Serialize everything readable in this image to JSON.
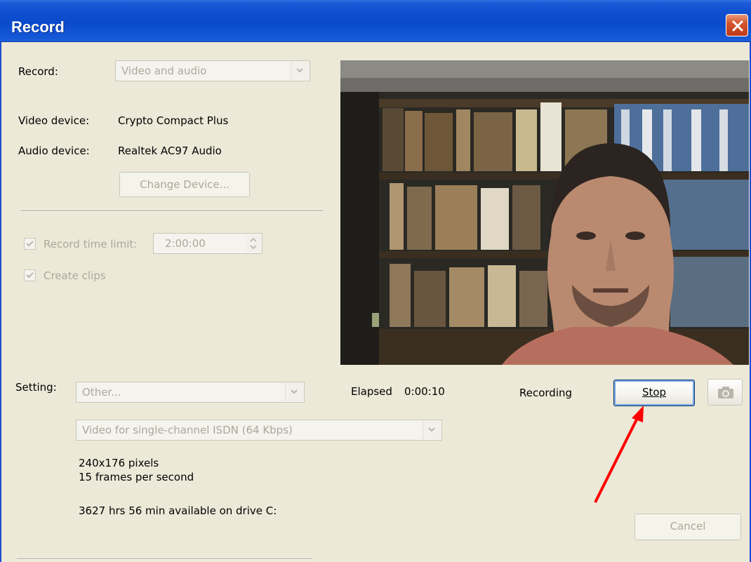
{
  "window": {
    "title": "Record"
  },
  "record": {
    "label": "Record:",
    "mode_value": "Video and audio"
  },
  "devices": {
    "video_label": "Video device:",
    "video_value": "Crypto Compact Plus",
    "audio_label": "Audio device:",
    "audio_value": "Realtek AC97 Audio",
    "change_button": "Change Device..."
  },
  "options": {
    "time_limit_label": "Record time limit:",
    "time_limit_value": "2:00:00",
    "time_limit_checked": true,
    "create_clips_label": "Create clips",
    "create_clips_checked": true
  },
  "status": {
    "elapsed_label": "Elapsed",
    "elapsed_value": "0:00:10",
    "state": "Recording",
    "stop_button": "Stop"
  },
  "setting": {
    "label": "Setting:",
    "profile_value": "Other...",
    "format_value": "Video for single-channel ISDN (64 Kbps)",
    "resolution": "240x176 pixels",
    "framerate": "15 frames per second",
    "available": "3627 hrs  56 min available on drive C:"
  },
  "footer": {
    "cancel_button": "Cancel"
  },
  "icons": {
    "close": "close-icon",
    "dropdown": "chevron-down-icon",
    "camera": "camera-icon",
    "check": "checkmark-icon",
    "annotation": "red-arrow"
  },
  "colors": {
    "titlebar": "#0a4acb",
    "dialog_bg": "#ece9d8",
    "disabled_text": "#aca899",
    "close_button": "#d4552c",
    "annotation_arrow": "#ff0000"
  }
}
